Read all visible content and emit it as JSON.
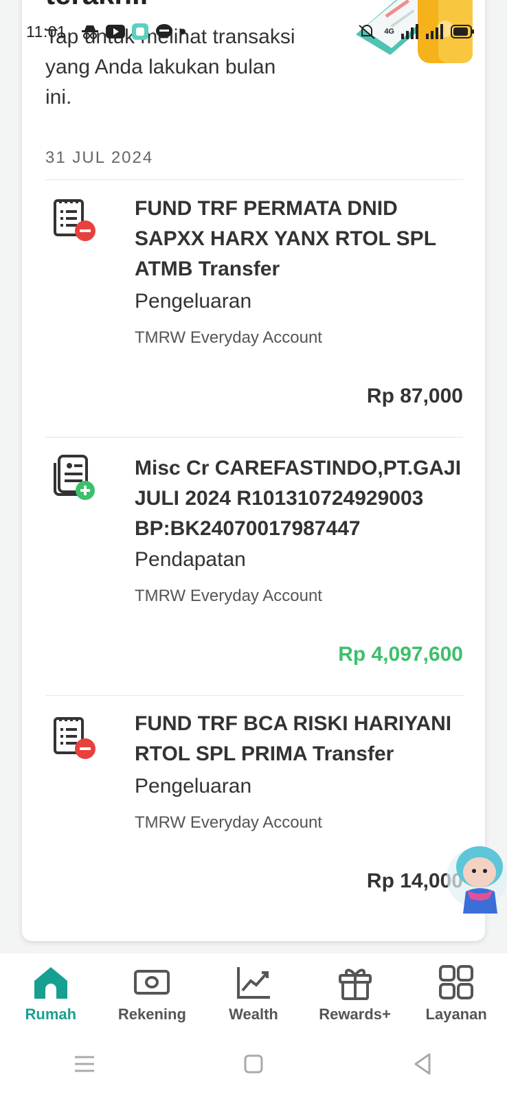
{
  "status_bar": {
    "time": "11:01",
    "network": "4G"
  },
  "card": {
    "heading_partial": "terakhir",
    "intro": "Tap untuk melihat transaksi yang Anda lakukan bulan ini.",
    "date": "31 JUL 2024"
  },
  "transactions": [
    {
      "title": "FUND TRF PERMATA DNID SAPXX HARX YANX RTOL SPL ATMB Transfer",
      "type": "Pengeluaran",
      "account": "TMRW Everyday Account",
      "amount": "Rp 87,000",
      "icon": "expense-receipt-icon"
    },
    {
      "title": "Misc Cr CAREFASTINDO,PT.GAJI JULI 2024 R101310724929003 BP:BK24070017987447",
      "type": "Pendapatan",
      "account": "TMRW Everyday Account",
      "amount": "Rp 4,097,600",
      "icon": "income-document-icon"
    },
    {
      "title": "FUND TRF BCA RISKI HARIYANI RTOL SPL PRIMA Transfer",
      "type": "Pengeluaran",
      "account": "TMRW Everyday Account",
      "amount": "Rp 14,000",
      "icon": "expense-receipt-icon"
    }
  ],
  "bottom_nav": [
    {
      "label": "Rumah",
      "icon": "home-icon",
      "active": true
    },
    {
      "label": "Rekening",
      "icon": "money-icon",
      "active": false
    },
    {
      "label": "Wealth",
      "icon": "chart-icon",
      "active": false
    },
    {
      "label": "Rewards+",
      "icon": "gift-icon",
      "active": false
    },
    {
      "label": "Layanan",
      "icon": "grid-icon",
      "active": false
    }
  ],
  "colors": {
    "accent": "#17a091",
    "income": "#3dbf6b",
    "expense_badge": "#e8413d",
    "income_badge": "#3dbf6b"
  }
}
